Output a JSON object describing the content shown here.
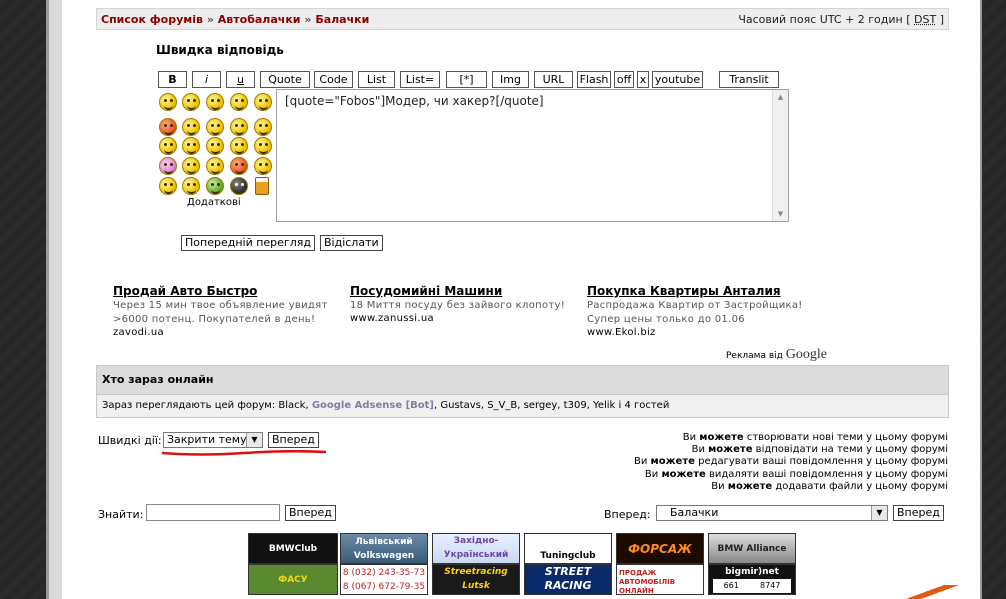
{
  "nav": {
    "breadcrumb": [
      "Список форумів",
      "Автобалачки",
      "Балачки"
    ],
    "separator": "»",
    "timezone": "Часовий пояс UTC + 2 годин [",
    "dst": "DST",
    "tz_close": "]"
  },
  "quick_reply": {
    "title": "Швидка відповідь",
    "toolbar": [
      "B",
      "i",
      "u",
      "Quote",
      "Code",
      "List",
      "List=",
      "[*]",
      "Img",
      "URL",
      "Flash",
      "off",
      "x",
      "youtube",
      "Translit"
    ],
    "more_smilies": "Додаткові",
    "message": "[quote=\"Fobos\"]Модер, чи хакер?[/quote]",
    "preview_button": "Попередній перегляд",
    "submit_button": "Відіслати"
  },
  "ads": [
    {
      "title": "Продай Авто Быстро",
      "desc1": "Через 15 мин твое объявление увидят",
      "desc2": ">6000 потенц. Покупателей в день!",
      "url": "zavodi.ua"
    },
    {
      "title": "Посудомийні Машини",
      "desc1": "18 Миття посуду без зайвого клопоту!",
      "desc2": "",
      "url": "www.zanussi.ua"
    },
    {
      "title": "Покупка Квартиры Анталия",
      "desc1": "Распродажа Квартир от Застройщика!",
      "desc2": "Супер цены только до 01.06",
      "url": "www.Ekol.biz"
    }
  ],
  "adsense": {
    "prefix": "Реклама від",
    "brand": "Google"
  },
  "online": {
    "heading": "Хто зараз онлайн",
    "text_before": "Зараз переглядають цей форум: Black,",
    "bot": "Google Adsense [Bot]",
    "text_after": ", Gustavs, S_V_B, sergey, t309, Yelik і 4 гостей"
  },
  "quick_actions": {
    "label": "Швидкі дії:",
    "selected": "Закрити тему",
    "go_button": "Вперед"
  },
  "permissions": [
    {
      "a": "Ви",
      "b": "можете",
      "c": "створювати нові теми у цьому форумі"
    },
    {
      "a": "Ви",
      "b": "можете",
      "c": "відповідати на теми у цьому форумі"
    },
    {
      "a": "Ви",
      "b": "можете",
      "c": "редагувати ваші повідомлення у цьому форумі"
    },
    {
      "a": "Ви",
      "b": "можете",
      "c": "видаляти ваші повідомлення у цьому форумі"
    },
    {
      "a": "Ви",
      "b": "можете",
      "c": "додавати файли у цьому форумі"
    }
  ],
  "search": {
    "label": "Знайти:",
    "value": "",
    "button": "Вперед"
  },
  "jump": {
    "label": "Вперед:",
    "selected": "Балачки",
    "button": "Вперед"
  },
  "banners": {
    "row1": [
      "BMWClub",
      "Львівський Volkswagen клуб",
      "Західно-Український АВТОБАЗАР",
      "Tuningclub",
      "ФОРСАЖ",
      "BMW Alliance"
    ],
    "row2": [
      "ФАСУ",
      "8 (032) 243-35-73",
      "8 (067) 672-79-35",
      "Streetracing Lutsk",
      "STREET RACING",
      "ПРОДАЖ АВТОМОБІЛІВ ОНЛАЙН",
      "bigmir)net",
      "661",
      "8747"
    ]
  },
  "colors": {
    "link": "#8b0000",
    "accent_red": "#e01010",
    "bot": "#8a7aa0"
  }
}
